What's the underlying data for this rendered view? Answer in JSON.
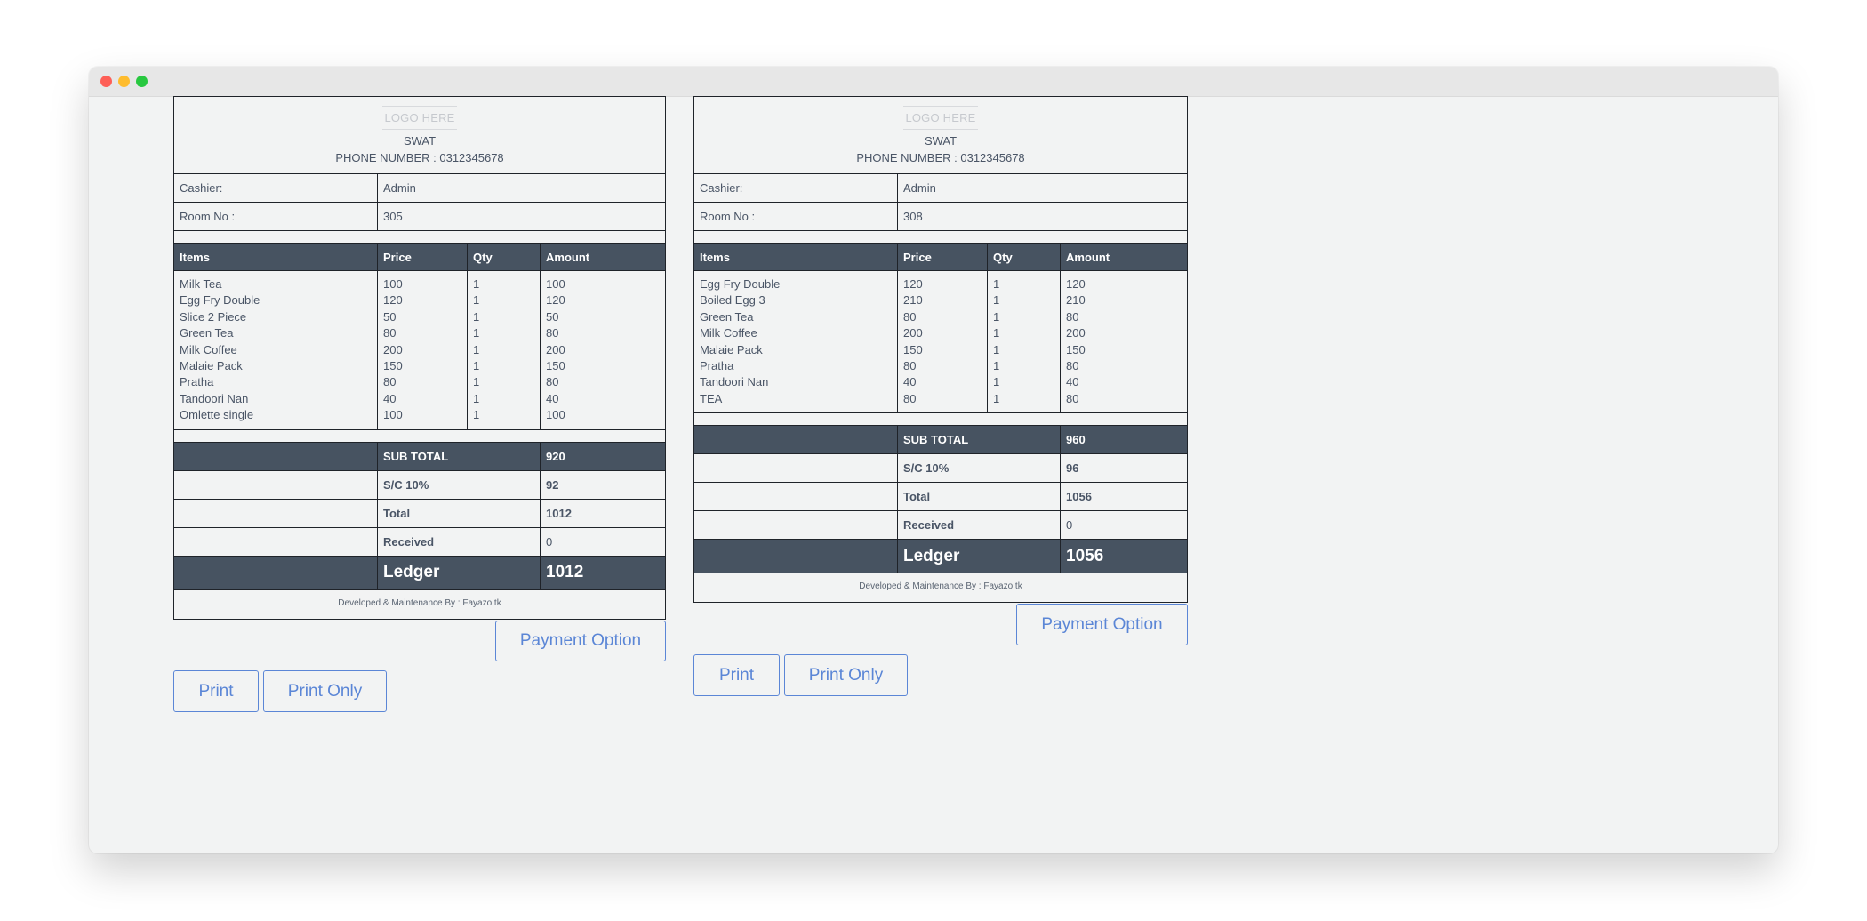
{
  "receipts": [
    {
      "logo": "LOGO HERE",
      "shop": "SWAT",
      "phone": "PHONE NUMBER : 0312345678",
      "cashier_label": "Cashier:",
      "cashier": "Admin",
      "room_label": "Room No :",
      "room": "305",
      "headers": {
        "items": "Items",
        "price": "Price",
        "qty": "Qty",
        "amount": "Amount"
      },
      "items": [
        {
          "name": "Milk Tea",
          "price": "100",
          "qty": "1",
          "amount": "100"
        },
        {
          "name": "Egg Fry Double",
          "price": "120",
          "qty": "1",
          "amount": "120"
        },
        {
          "name": "Slice 2 Piece",
          "price": "50",
          "qty": "1",
          "amount": "50"
        },
        {
          "name": "Green Tea",
          "price": "80",
          "qty": "1",
          "amount": "80"
        },
        {
          "name": "Milk Coffee",
          "price": "200",
          "qty": "1",
          "amount": "200"
        },
        {
          "name": "Malaie Pack",
          "price": "150",
          "qty": "1",
          "amount": "150"
        },
        {
          "name": "Pratha",
          "price": "80",
          "qty": "1",
          "amount": "80"
        },
        {
          "name": "Tandoori Nan",
          "price": "40",
          "qty": "1",
          "amount": "40"
        },
        {
          "name": "Omlette single",
          "price": "100",
          "qty": "1",
          "amount": "100"
        }
      ],
      "subtotal_label": "SUB TOTAL",
      "subtotal": "920",
      "sc_label": "S/C 10%",
      "sc": "92",
      "total_label": "Total",
      "total": "1012",
      "received_label": "Received",
      "received": "0",
      "ledger_label": "Ledger",
      "ledger": "1012",
      "footer": "Developed & Maintenance By : Fayazo.tk",
      "payment_button": "Payment Option",
      "print_button": "Print",
      "print_only_button": "Print Only"
    },
    {
      "logo": "LOGO HERE",
      "shop": "SWAT",
      "phone": "PHONE NUMBER : 0312345678",
      "cashier_label": "Cashier:",
      "cashier": "Admin",
      "room_label": "Room No :",
      "room": "308",
      "headers": {
        "items": "Items",
        "price": "Price",
        "qty": "Qty",
        "amount": "Amount"
      },
      "items": [
        {
          "name": "Egg Fry Double",
          "price": "120",
          "qty": "1",
          "amount": "120"
        },
        {
          "name": "Boiled Egg 3",
          "price": "210",
          "qty": "1",
          "amount": "210"
        },
        {
          "name": "Green Tea",
          "price": "80",
          "qty": "1",
          "amount": "80"
        },
        {
          "name": "Milk Coffee",
          "price": "200",
          "qty": "1",
          "amount": "200"
        },
        {
          "name": "Malaie Pack",
          "price": "150",
          "qty": "1",
          "amount": "150"
        },
        {
          "name": "Pratha",
          "price": "80",
          "qty": "1",
          "amount": "80"
        },
        {
          "name": "Tandoori Nan",
          "price": "40",
          "qty": "1",
          "amount": "40"
        },
        {
          "name": "TEA",
          "price": "80",
          "qty": "1",
          "amount": "80"
        }
      ],
      "subtotal_label": "SUB TOTAL",
      "subtotal": "960",
      "sc_label": "S/C 10%",
      "sc": "96",
      "total_label": "Total",
      "total": "1056",
      "received_label": "Received",
      "received": "0",
      "ledger_label": "Ledger",
      "ledger": "1056",
      "footer": "Developed & Maintenance By : Fayazo.tk",
      "payment_button": "Payment Option",
      "print_button": "Print",
      "print_only_button": "Print Only"
    }
  ]
}
